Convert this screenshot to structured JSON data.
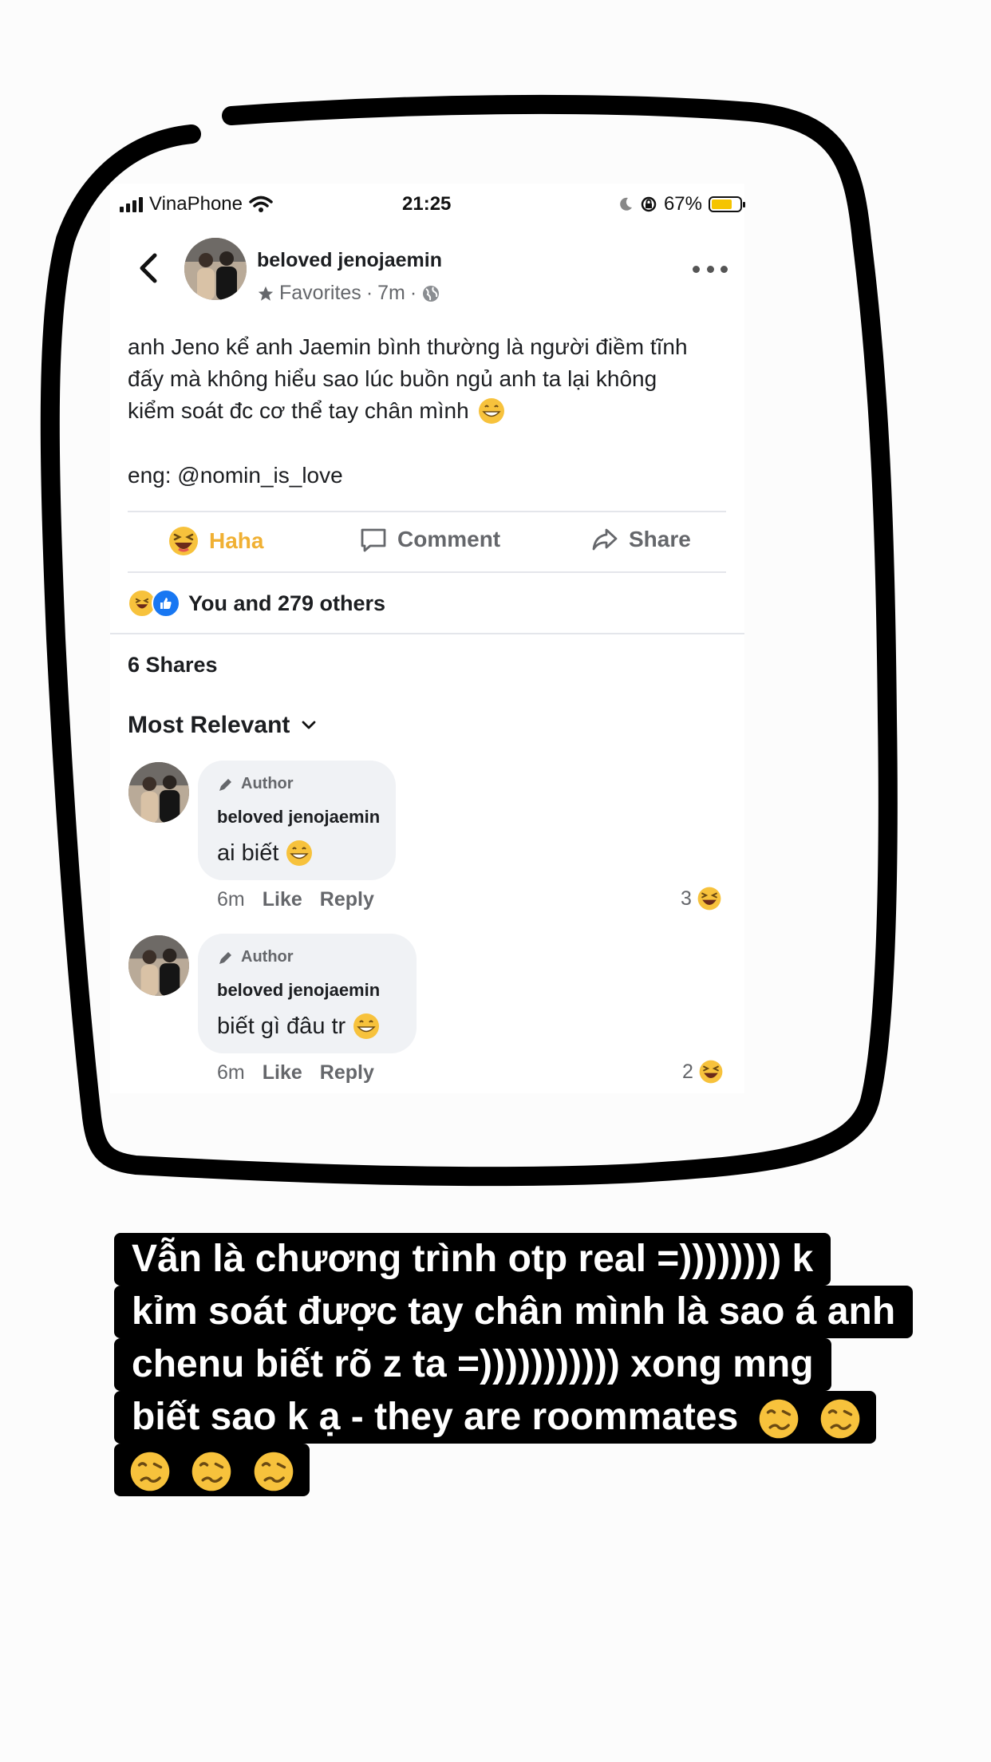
{
  "status_bar": {
    "carrier": "VinaPhone",
    "time": "21:25",
    "battery": "67%",
    "battery_level": 0.67
  },
  "post": {
    "author": "beloved jenojaemin",
    "audience": "Favorites",
    "age": "7m",
    "text_lines": [
      "anh Jeno kể anh Jaemin bình thường là người điềm tĩnh",
      "đấy mà không hiểu sao lúc buồn ngủ anh ta lại không",
      "kiểm soát đc cơ thể tay chân mình"
    ],
    "eng_credit": "eng: @nomin_is_love",
    "actions": {
      "reaction": "Haha",
      "comment": "Comment",
      "share": "Share"
    },
    "reactions_summary": "You and 279 others",
    "shares": "6 Shares",
    "sort": "Most Relevant"
  },
  "comments": [
    {
      "badge": "Author",
      "name": "beloved jenojaemin",
      "text": "ai biết",
      "age": "6m",
      "like": "Like",
      "reply": "Reply",
      "reactions": "3"
    },
    {
      "badge": "Author",
      "name": "beloved jenojaemin",
      "text": "biết gì đâu tr",
      "age": "6m",
      "like": "Like",
      "reply": "Reply",
      "reactions": "2"
    }
  ],
  "caption": {
    "lines": [
      "Vẫn là chương trình otp real =)))))))) k",
      "kỉm soát được tay chân mình là sao á anh",
      "chenu biết rõ z ta =))))))))))) xong mng",
      "biết sao k ạ - they are roommates"
    ]
  },
  "colors": {
    "haha": "#f0b033",
    "like_blue": "#1877f2",
    "muted": "#65676b",
    "bubble": "#f0f2f5"
  }
}
